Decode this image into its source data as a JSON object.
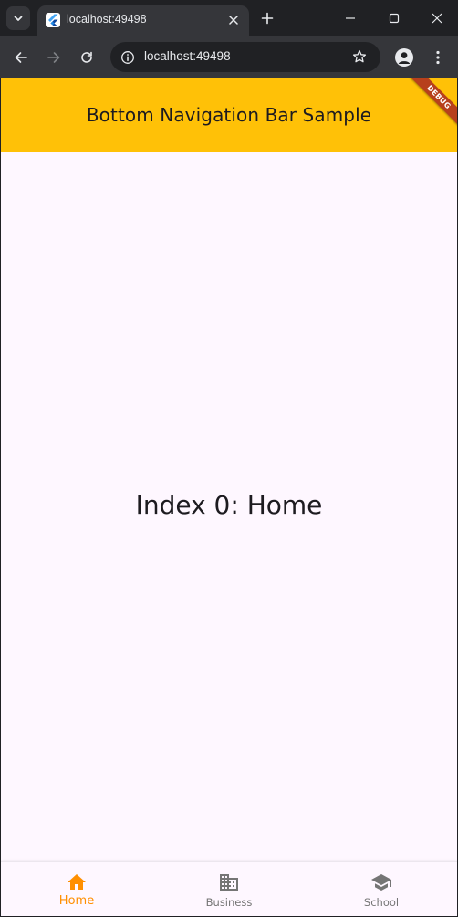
{
  "browser": {
    "tab_title": "localhost:49498",
    "address": "localhost:49498",
    "icons": {
      "tab_search": "chevron-down-icon",
      "favicon": "flutter-icon",
      "tab_close": "close-icon",
      "new_tab": "plus-icon",
      "minimize": "minimize-icon",
      "maximize": "maximize-icon",
      "close_window": "close-icon",
      "back": "arrow-left-icon",
      "forward": "arrow-right-icon",
      "reload": "reload-icon",
      "site_info": "info-icon",
      "bookmark": "star-icon",
      "profile": "person-icon",
      "menu": "kebab-menu-icon"
    }
  },
  "app": {
    "title": "Bottom Navigation Bar Sample",
    "debug_banner": "DEBUG",
    "body_text": "Index 0: Home",
    "colors": {
      "appbar": "#ffc107",
      "background": "#fef7ff",
      "selected": "#ff8f00",
      "unselected": "#757575",
      "debug_banner": "#b7401c"
    },
    "bottom_nav": {
      "selected_index": 0,
      "items": [
        {
          "label": "Home",
          "icon": "home-icon"
        },
        {
          "label": "Business",
          "icon": "business-icon"
        },
        {
          "label": "School",
          "icon": "school-icon"
        }
      ]
    }
  }
}
